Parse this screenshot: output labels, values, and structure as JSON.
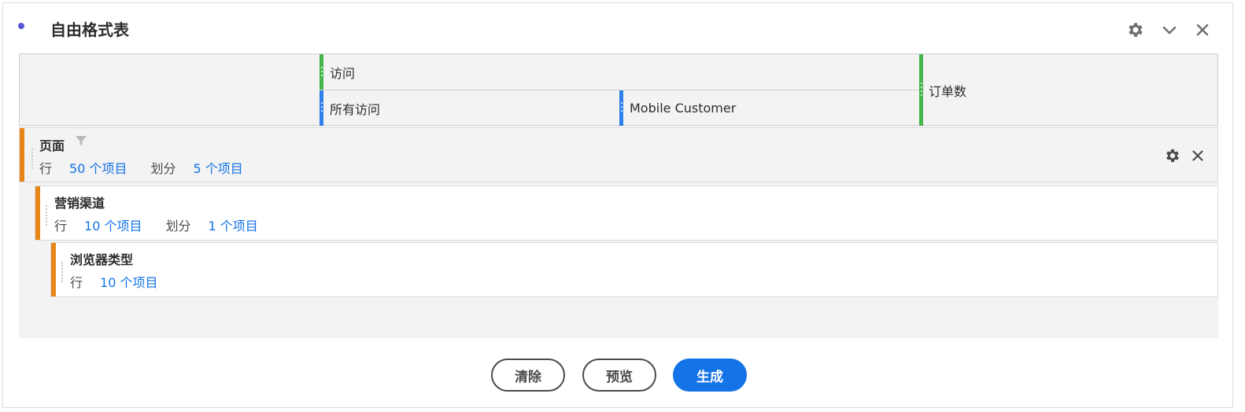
{
  "panel": {
    "title": "自由格式表"
  },
  "columns": {
    "top_metric": "访问",
    "segment_all": "所有访问",
    "segment_mobile": "Mobile Customer",
    "second_metric": "订单数"
  },
  "rows": [
    {
      "name": "页面",
      "row_label": "行",
      "row_count": "50 个项目",
      "breakdown_label": "划分",
      "breakdown_count": "5 个项目"
    },
    {
      "name": "营销渠道",
      "row_label": "行",
      "row_count": "10 个项目",
      "breakdown_label": "划分",
      "breakdown_count": "1 个项目"
    },
    {
      "name": "浏览器类型",
      "row_label": "行",
      "row_count": "10 个项目"
    }
  ],
  "buttons": {
    "clear": "清除",
    "preview": "预览",
    "build": "生成"
  },
  "colors": {
    "accent_purple": "#5a57d6",
    "metric_green": "#45b649",
    "segment_blue": "#2f80ed",
    "dimension_orange": "#e68619",
    "link_blue": "#1473e6"
  }
}
